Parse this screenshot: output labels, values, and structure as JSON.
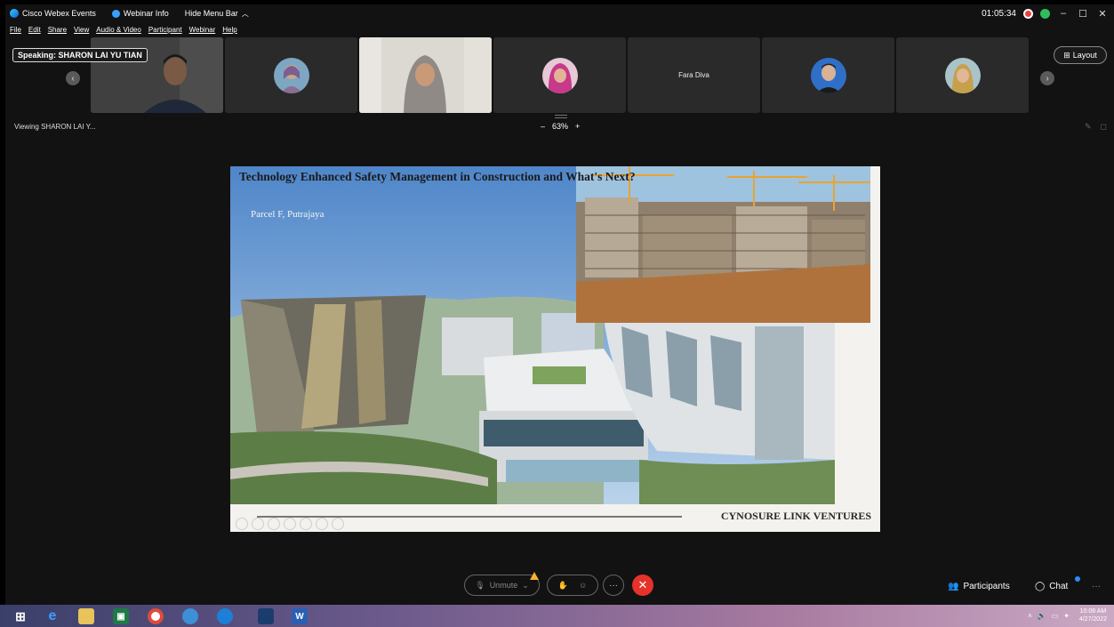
{
  "titlebar": {
    "app_name": "Cisco Webex Events",
    "webinar_info": "Webinar Info",
    "hide_menu": "Hide Menu Bar",
    "timer": "01:05:34",
    "minimize": "–",
    "restore": "☐",
    "close": "✕"
  },
  "menubar": [
    "File",
    "Edit",
    "Share",
    "View",
    "Audio & Video",
    "Participant",
    "Webinar",
    "Help"
  ],
  "strip": {
    "speaking_label": "Speaking: SHARON LAI YU TIAN",
    "prev": "‹",
    "next": "›",
    "tile_name": "Fara Diva",
    "layout_label": "Layout"
  },
  "viewbar": {
    "viewing": "Viewing SHARON LAI Y...",
    "zoom_minus": "–",
    "zoom_level": "63%",
    "zoom_plus": "+"
  },
  "slide": {
    "title": "Technology Enhanced Safety Management in Construction and What's Next?",
    "location": "Parcel F, Putrajaya",
    "brand": "CYNOSURE LINK VENTURES"
  },
  "controls": {
    "unmute": "Unmute",
    "more": "···",
    "end": "✕",
    "participants": "Participants",
    "chat": "Chat",
    "overflow": "···"
  },
  "taskbar": {
    "time": "10:08 AM",
    "date": "4/27/2022"
  },
  "colors": {
    "end_call": "#e5332a",
    "warning": "#f7b32b",
    "app_bg": "#121212"
  }
}
